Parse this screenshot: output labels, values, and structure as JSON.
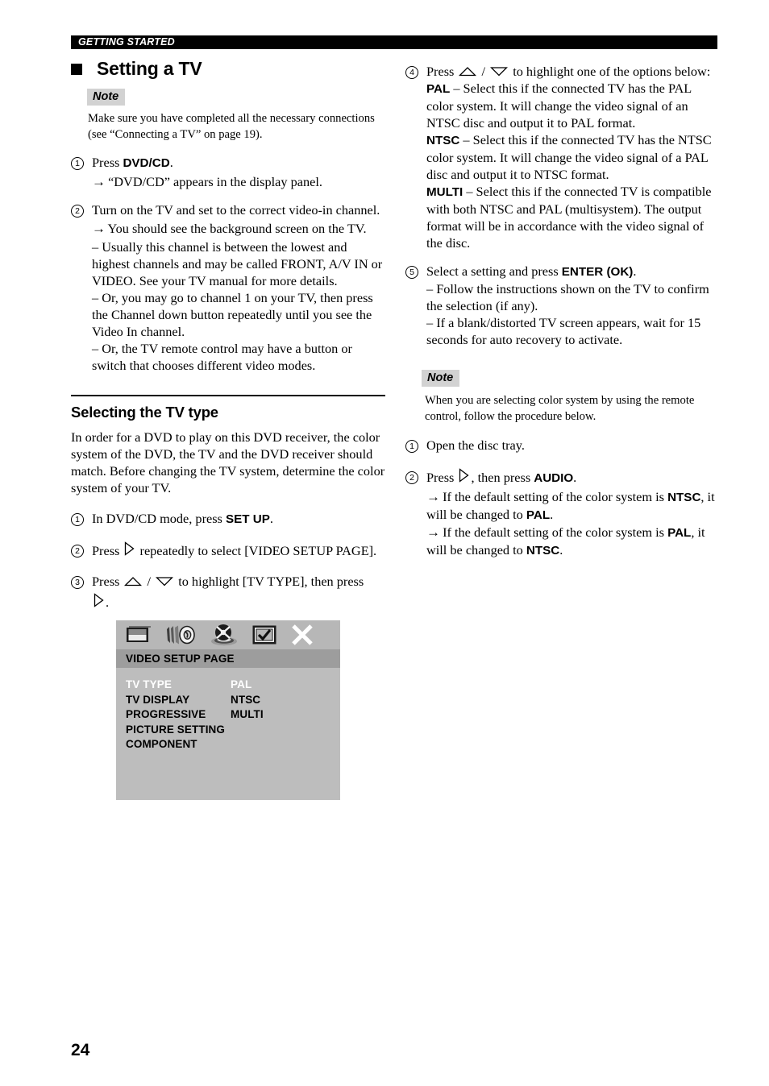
{
  "header": {
    "section_label": "GETTING STARTED"
  },
  "title": {
    "text": "Setting a TV",
    "bullet": "black-square"
  },
  "page_number": "24",
  "left_column": {
    "note": {
      "label": "Note",
      "body": "Make sure you have completed all the necessary connections (see “Connecting a TV” on page 19)."
    },
    "steps": [
      {
        "num": "1",
        "text_before": "Press ",
        "bold": "DVD/CD",
        "text_after": ".",
        "sub": [
          {
            "marker": "→",
            "text": "“DVD/CD” appears in the display panel."
          }
        ]
      },
      {
        "num": "2",
        "text_before": "Turn on the TV and set to the correct video-in channel.",
        "bold": "",
        "text_after": "",
        "sub": [
          {
            "marker": "→",
            "text": "You should see the background screen on the TV."
          },
          {
            "marker": "–",
            "text": "Usually this channel is between the lowest and highest channels and may be called FRONT, A/V IN or VIDEO. See your TV manual for more details."
          },
          {
            "marker": "–",
            "text": "Or, you may go to channel 1 on your TV, then press the Channel down button repeatedly until you see the Video In channel."
          },
          {
            "marker": "–",
            "text": "Or, the TV remote control may have a button or switch that chooses different video modes."
          }
        ]
      }
    ],
    "section": {
      "heading": "Selecting the TV type",
      "paragraph": "In order for a DVD to play on this DVD receiver, the color system of the DVD, the TV and the DVD receiver should match. Before changing the TV system, determine the color system of your TV.",
      "steps": [
        {
          "num": "1",
          "part1": "In DVD/CD mode, press ",
          "bold": "SET UP",
          "part2": "."
        },
        {
          "num": "2",
          "part1": "Press ",
          "icon": "triangle-right-icon",
          "part2": " repeatedly to select [VIDEO SETUP PAGE]."
        },
        {
          "num": "3",
          "part1": "Press ",
          "icon_up": "triangle-up-icon",
          "separator": " / ",
          "icon_down": "triangle-down-icon",
          "part2": " to highlight [TV TYPE], then press ",
          "icon_trail": "triangle-right-icon",
          "part3": "."
        }
      ]
    }
  },
  "osd": {
    "icons": [
      "tv-screen-icon",
      "speaker-audio-icon",
      "disc-preferences-icon",
      "picture-setup-icon",
      "close-x-icon"
    ],
    "title": "VIDEO SETUP PAGE",
    "menu_items": [
      {
        "label": "TV TYPE",
        "selected": true
      },
      {
        "label": "TV DISPLAY",
        "selected": false
      },
      {
        "label": "PROGRESSIVE",
        "selected": false
      },
      {
        "label": "PICTURE SETTING",
        "selected": false
      },
      {
        "label": "COMPONENT",
        "selected": false
      }
    ],
    "values": [
      {
        "label": "PAL",
        "selected": true
      },
      {
        "label": "NTSC",
        "selected": false
      },
      {
        "label": "MULTI",
        "selected": false
      }
    ],
    "colors": {
      "icon_bar": "#b7b7b7",
      "title_bar": "#9d9d9d",
      "body": "#bdbdbd",
      "selected_text": "#ffffff",
      "normal_text": "#000000"
    }
  },
  "right_column": {
    "steps": [
      {
        "num": "4",
        "part1": "Press ",
        "icon_up": "triangle-up-icon",
        "separator": " / ",
        "icon_down": "triangle-down-icon",
        "part2": " to highlight one of the options below:",
        "options": [
          {
            "name": "PAL",
            "desc": "– Select this if the connected TV has the PAL color system. It will change the video signal of an NTSC disc and output it to PAL format."
          },
          {
            "name": "NTSC",
            "desc": "– Select this if the connected TV has the NTSC color system. It will change the video signal of a PAL disc and output it to NTSC format."
          },
          {
            "name": "MULTI",
            "desc": "– Select this if the connected TV is compatible with both NTSC and PAL (multisystem). The output format will be in accordance with the video signal of the disc."
          }
        ]
      },
      {
        "num": "5",
        "part1": "Select a setting and press ",
        "bold": "ENTER (OK)",
        "part2": ".",
        "sub": [
          {
            "marker": "–",
            "text": "Follow the instructions shown on the TV to confirm the selection (if any)."
          },
          {
            "marker": "–",
            "text": "If a blank/distorted TV screen appears, wait for 15 seconds for auto recovery to activate."
          }
        ]
      }
    ],
    "note": {
      "label": "Note",
      "body": "When you are selecting color system by using the remote control, follow the procedure below."
    },
    "note_steps": [
      {
        "num": "1",
        "part1": "Open the disc tray.",
        "subs": []
      },
      {
        "num": "2",
        "part1": "Press ",
        "icon": "triangle-right-icon",
        "part2": ", then press ",
        "bold": "AUDIO",
        "part3": ".",
        "subs": [
          {
            "marker": "→",
            "pre": "If the default setting of the color system is ",
            "b1": "NTSC",
            "mid": ", it will be changed to ",
            "b2": "PAL",
            "post": "."
          },
          {
            "marker": "→",
            "pre": "If the default setting of the color system is ",
            "b1": "PAL",
            "mid": ", it will be changed to ",
            "b2": "NTSC",
            "post": "."
          }
        ]
      }
    ]
  }
}
